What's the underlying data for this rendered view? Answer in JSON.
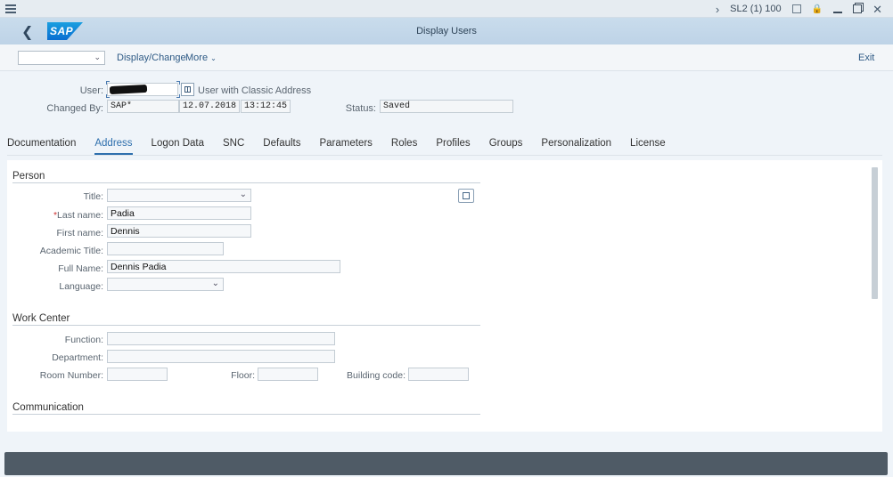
{
  "system": {
    "session": "SL2 (1) 100"
  },
  "titlebar": {
    "logo_text": "SAP",
    "title": "Display Users"
  },
  "toolbar": {
    "select_value": "",
    "display_change": "Display/Change",
    "more": "More",
    "exit": "Exit"
  },
  "header": {
    "user_label": "User:",
    "user_value": "",
    "classic_address": "User with Classic Address",
    "changed_by_label": "Changed By:",
    "changed_by_value": "SAP*",
    "date_value": "12.07.2018",
    "time_value": "13:12:45",
    "status_label": "Status:",
    "status_value": "Saved"
  },
  "tabs": [
    {
      "label": "Documentation"
    },
    {
      "label": "Address"
    },
    {
      "label": "Logon Data"
    },
    {
      "label": "SNC"
    },
    {
      "label": "Defaults"
    },
    {
      "label": "Parameters"
    },
    {
      "label": "Roles"
    },
    {
      "label": "Profiles"
    },
    {
      "label": "Groups"
    },
    {
      "label": "Personalization"
    },
    {
      "label": "License"
    }
  ],
  "active_tab": "Address",
  "person": {
    "title": "Person",
    "title_label": "Title:",
    "title_value": "",
    "last_name_label": "Last name:",
    "last_name_value": "Padia",
    "first_name_label": "First name:",
    "first_name_value": "Dennis",
    "academic_title_label": "Academic Title:",
    "academic_title_value": "",
    "full_name_label": "Full Name:",
    "full_name_value": "Dennis Padia",
    "language_label": "Language:",
    "language_value": ""
  },
  "work_center": {
    "title": "Work Center",
    "function_label": "Function:",
    "department_label": "Department:",
    "room_label": "Room Number:",
    "floor_label": "Floor:",
    "building_label": "Building code:"
  },
  "communication": {
    "title": "Communication"
  },
  "colors": {
    "accent": "#2e6fad",
    "titlebar": "#c5d9ec",
    "statusbar": "#4f5b66"
  }
}
